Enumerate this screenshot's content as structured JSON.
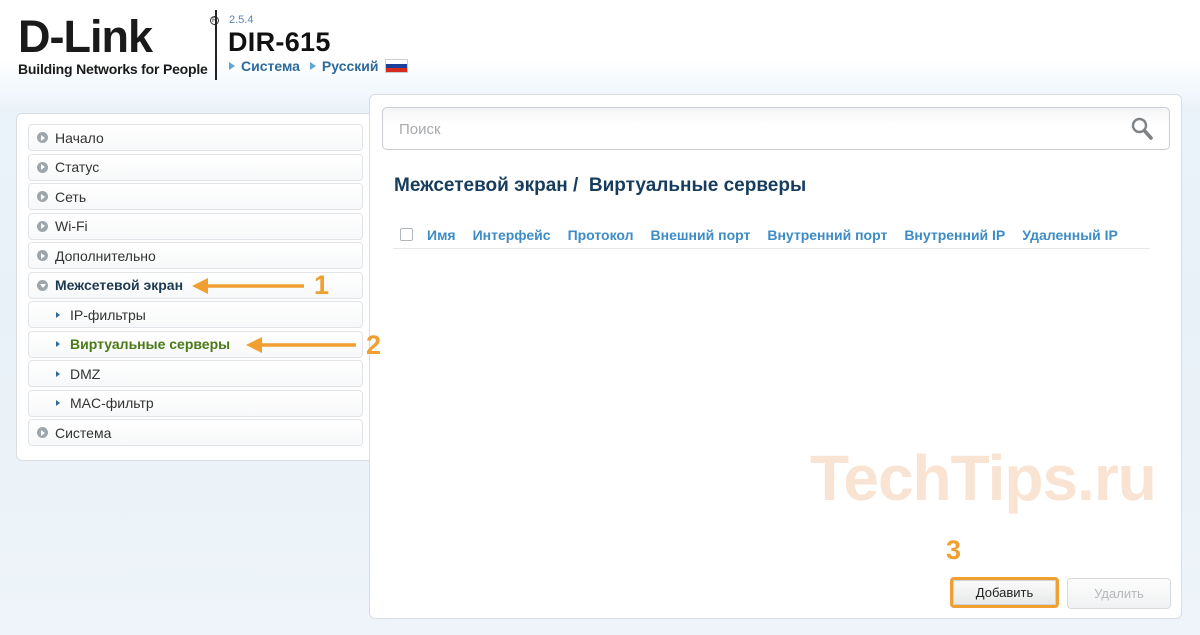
{
  "header": {
    "logo_text": "D-Link",
    "logo_mark": "R",
    "tagline": "Building Networks for People",
    "firmware_version": "2.5.4",
    "model": "DIR-615",
    "links": [
      {
        "label": "Система"
      },
      {
        "label": "Русский"
      }
    ],
    "flag_colors": [
      "#ffffff",
      "#1c3f9c",
      "#d52b1e"
    ]
  },
  "sidebar": {
    "items": [
      {
        "label": "Начало"
      },
      {
        "label": "Статус"
      },
      {
        "label": "Сеть"
      },
      {
        "label": "Wi-Fi"
      },
      {
        "label": "Дополнительно"
      },
      {
        "label": "Межсетевой экран",
        "expanded": true
      },
      {
        "label": "IP-фильтры",
        "sub": true
      },
      {
        "label": "Виртуальные серверы",
        "sub": true,
        "active": true
      },
      {
        "label": "DMZ",
        "sub": true
      },
      {
        "label": "MAC-фильтр",
        "sub": true
      },
      {
        "label": "Система"
      }
    ]
  },
  "main": {
    "search_placeholder": "Поиск",
    "title": "Межсетевой экран /  Виртуальные серверы",
    "table": {
      "columns": [
        "Имя",
        "Интерфейс",
        "Протокол",
        "Внешний порт",
        "Внутренний порт",
        "Внутренний IP",
        "Удаленный IP"
      ],
      "rows": []
    },
    "buttons": {
      "add": "Добавить",
      "delete": "Удалить"
    }
  },
  "watermark": "TechTips.ru",
  "annotations": {
    "step1": "1",
    "step2": "2",
    "step3": "3",
    "color": "#f0a032"
  }
}
